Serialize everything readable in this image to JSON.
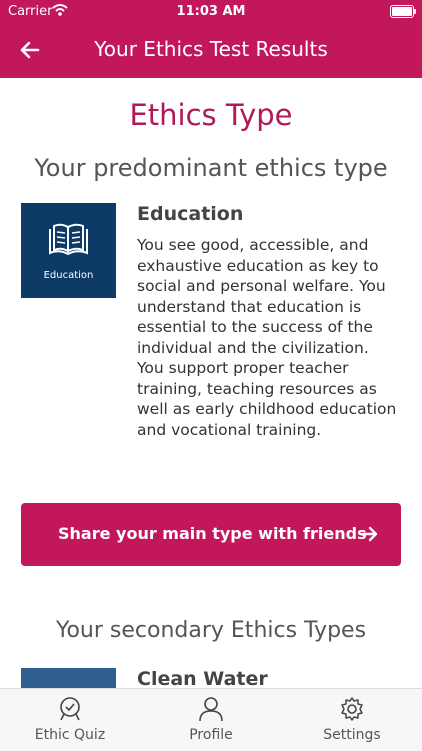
{
  "status": {
    "carrier": "Carrier",
    "time": "11:03 AM"
  },
  "header": {
    "title": "Your Ethics Test Results"
  },
  "section": {
    "heading": "Ethics Type",
    "subheading": "Your predominant ethics type"
  },
  "main_type": {
    "icon_caption": "Education",
    "title": "Education",
    "description": "You see good, accessible, and exhaustive education as key to social and personal welfare. You understand that education is essential to the success of the individual and the civilization. You support proper teacher training, teaching resources as well as early childhood education and vocational training."
  },
  "share_button": {
    "label": "Share your main type with friends"
  },
  "secondary": {
    "heading": "Your secondary Ethics Types",
    "first_title": "Clean Water"
  },
  "tabs": [
    {
      "label": "Ethic Quiz",
      "icon": "quiz-check-icon"
    },
    {
      "label": "Profile",
      "icon": "profile-icon"
    },
    {
      "label": "Settings",
      "icon": "gear-icon"
    }
  ],
  "colors": {
    "brand": "#c2185b",
    "card": "#0d3a66"
  }
}
